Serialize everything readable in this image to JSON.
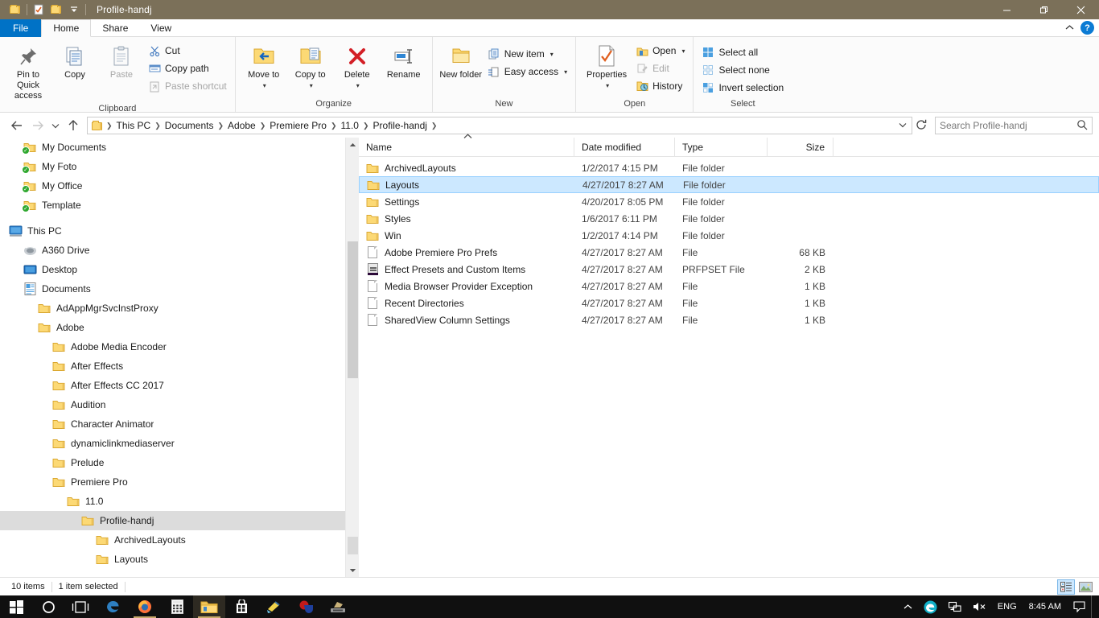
{
  "window": {
    "title": "Profile-handj",
    "titlebar_color": "#7b7059",
    "quick_access": [
      "folder-icon",
      "properties-icon",
      "new-folder-icon",
      "customize-dropdown"
    ],
    "controls": {
      "minimize": "—",
      "maximize": "❐",
      "close": "✕"
    }
  },
  "ribbon": {
    "tabs": [
      {
        "label": "File",
        "active": false,
        "kind": "file"
      },
      {
        "label": "Home",
        "active": true,
        "kind": "normal"
      },
      {
        "label": "Share",
        "active": false,
        "kind": "normal"
      },
      {
        "label": "View",
        "active": false,
        "kind": "normal"
      }
    ],
    "collapse_icon": "chevron-up-icon",
    "help_label": "?",
    "groups": [
      {
        "name": "Clipboard",
        "big_buttons": [
          {
            "label": "Pin to Quick access",
            "icon": "pin-icon",
            "disabled": false
          },
          {
            "label": "Copy",
            "icon": "copy-icon",
            "disabled": false
          },
          {
            "label": "Paste",
            "icon": "paste-icon",
            "disabled": true
          }
        ],
        "small_buttons": [
          {
            "label": "Cut",
            "icon": "scissors-icon",
            "disabled": false
          },
          {
            "label": "Copy path",
            "icon": "copy-path-icon",
            "disabled": false
          },
          {
            "label": "Paste shortcut",
            "icon": "paste-shortcut-icon",
            "disabled": true
          }
        ]
      },
      {
        "name": "Organize",
        "big_buttons": [
          {
            "label": "Move to",
            "icon": "move-to-icon",
            "dropdown": true
          },
          {
            "label": "Copy to",
            "icon": "copy-to-icon",
            "dropdown": true
          },
          {
            "label": "Delete",
            "icon": "delete-icon",
            "dropdown": true
          },
          {
            "label": "Rename",
            "icon": "rename-icon",
            "dropdown": false
          }
        ]
      },
      {
        "name": "New",
        "big_buttons": [
          {
            "label": "New folder",
            "icon": "new-folder-icon"
          }
        ],
        "small_buttons": [
          {
            "label": "New item",
            "icon": "new-item-icon",
            "dropdown": true
          },
          {
            "label": "Easy access",
            "icon": "easy-access-icon",
            "dropdown": true
          }
        ]
      },
      {
        "name": "Open",
        "big_buttons": [
          {
            "label": "Properties",
            "icon": "properties-icon",
            "dropdown": true
          }
        ],
        "small_buttons": [
          {
            "label": "Open",
            "icon": "open-icon",
            "dropdown": true,
            "disabled": false
          },
          {
            "label": "Edit",
            "icon": "edit-icon",
            "disabled": true
          },
          {
            "label": "History",
            "icon": "history-icon",
            "disabled": false
          }
        ]
      },
      {
        "name": "Select",
        "small_buttons": [
          {
            "label": "Select all",
            "icon": "select-all-icon"
          },
          {
            "label": "Select none",
            "icon": "select-none-icon"
          },
          {
            "label": "Invert selection",
            "icon": "invert-selection-icon"
          }
        ]
      }
    ]
  },
  "address": {
    "back_icon": "arrow-left-icon",
    "forward_icon": "arrow-right-icon",
    "recent_icon": "chevron-down-icon",
    "up_icon": "arrow-up-icon",
    "breadcrumbs": [
      "This PC",
      "Documents",
      "Adobe",
      "Premiere Pro",
      "11.0",
      "Profile-handj"
    ],
    "dropdown_icon": "chevron-down-icon",
    "refresh_icon": "refresh-icon"
  },
  "search": {
    "placeholder": "Search Profile-handj",
    "value": "",
    "icon": "search-icon"
  },
  "navpane": {
    "items": [
      {
        "label": "My Documents",
        "icon": "folder-synced-icon",
        "indent": 1,
        "selected": false
      },
      {
        "label": "My Foto",
        "icon": "folder-synced-icon",
        "indent": 1,
        "selected": false
      },
      {
        "label": "My Office",
        "icon": "folder-synced-icon",
        "indent": 1,
        "selected": false
      },
      {
        "label": "Template",
        "icon": "folder-synced-icon",
        "indent": 1,
        "selected": false
      },
      {
        "label": "This PC",
        "icon": "this-pc-icon",
        "indent": 0,
        "selected": false,
        "gap_before": true
      },
      {
        "label": "A360 Drive",
        "icon": "a360-drive-icon",
        "indent": 1,
        "selected": false
      },
      {
        "label": "Desktop",
        "icon": "desktop-icon",
        "indent": 1,
        "selected": false
      },
      {
        "label": "Documents",
        "icon": "documents-icon",
        "indent": 1,
        "selected": false
      },
      {
        "label": "AdAppMgrSvcInstProxy",
        "icon": "folder-icon",
        "indent": 2,
        "selected": false
      },
      {
        "label": "Adobe",
        "icon": "folder-icon",
        "indent": 2,
        "selected": false
      },
      {
        "label": "Adobe Media Encoder",
        "icon": "folder-icon",
        "indent": 3,
        "selected": false
      },
      {
        "label": "After Effects",
        "icon": "folder-icon",
        "indent": 3,
        "selected": false
      },
      {
        "label": "After Effects CC 2017",
        "icon": "folder-icon",
        "indent": 3,
        "selected": false
      },
      {
        "label": "Audition",
        "icon": "folder-icon",
        "indent": 3,
        "selected": false
      },
      {
        "label": "Character Animator",
        "icon": "folder-icon",
        "indent": 3,
        "selected": false
      },
      {
        "label": "dynamiclinkmediaserver",
        "icon": "folder-icon",
        "indent": 3,
        "selected": false
      },
      {
        "label": "Prelude",
        "icon": "folder-icon",
        "indent": 3,
        "selected": false
      },
      {
        "label": "Premiere Pro",
        "icon": "folder-icon",
        "indent": 3,
        "selected": false
      },
      {
        "label": "11.0",
        "icon": "folder-icon",
        "indent": 4,
        "selected": false
      },
      {
        "label": "Profile-handj",
        "icon": "folder-icon",
        "indent": 5,
        "selected": true
      },
      {
        "label": "ArchivedLayouts",
        "icon": "folder-icon",
        "indent": 6,
        "selected": false
      },
      {
        "label": "Layouts",
        "icon": "folder-icon",
        "indent": 6,
        "selected": false
      }
    ]
  },
  "filelist": {
    "columns": [
      {
        "key": "name",
        "label": "Name",
        "sorted": "asc"
      },
      {
        "key": "date",
        "label": "Date modified"
      },
      {
        "key": "type",
        "label": "Type"
      },
      {
        "key": "size",
        "label": "Size"
      }
    ],
    "sort_icon": "caret-up-icon",
    "rows": [
      {
        "name": "ArchivedLayouts",
        "date": "1/2/2017 4:15 PM",
        "type": "File folder",
        "size": "",
        "icon": "folder-icon",
        "selected": false
      },
      {
        "name": "Layouts",
        "date": "4/27/2017 8:27 AM",
        "type": "File folder",
        "size": "",
        "icon": "folder-icon",
        "selected": true
      },
      {
        "name": "Settings",
        "date": "4/20/2017 8:05 PM",
        "type": "File folder",
        "size": "",
        "icon": "folder-icon",
        "selected": false
      },
      {
        "name": "Styles",
        "date": "1/6/2017 6:11 PM",
        "type": "File folder",
        "size": "",
        "icon": "folder-icon",
        "selected": false
      },
      {
        "name": "Win",
        "date": "1/2/2017 4:14 PM",
        "type": "File folder",
        "size": "",
        "icon": "folder-icon",
        "selected": false
      },
      {
        "name": "Adobe Premiere Pro Prefs",
        "date": "4/27/2017 8:27 AM",
        "type": "File",
        "size": "68 KB",
        "icon": "document-icon",
        "selected": false
      },
      {
        "name": "Effect Presets and Custom Items",
        "date": "4/27/2017 8:27 AM",
        "type": "PRFPSET File",
        "size": "2 KB",
        "icon": "prfpset-icon",
        "selected": false
      },
      {
        "name": "Media Browser Provider Exception",
        "date": "4/27/2017 8:27 AM",
        "type": "File",
        "size": "1 KB",
        "icon": "document-icon",
        "selected": false
      },
      {
        "name": "Recent Directories",
        "date": "4/27/2017 8:27 AM",
        "type": "File",
        "size": "1 KB",
        "icon": "document-icon",
        "selected": false
      },
      {
        "name": "SharedView Column Settings",
        "date": "4/27/2017 8:27 AM",
        "type": "File",
        "size": "1 KB",
        "icon": "document-icon",
        "selected": false
      }
    ]
  },
  "statusbar": {
    "item_count": "10 items",
    "selection": "1 item selected",
    "details_view_icon": "details-view-icon",
    "thumbnail_view_icon": "large-icons-view-icon"
  },
  "taskbar": {
    "items": [
      {
        "name": "start-button",
        "icon": "windows-logo-icon"
      },
      {
        "name": "cortana-button",
        "icon": "circle-icon"
      },
      {
        "name": "task-view-button",
        "icon": "task-view-icon"
      },
      {
        "name": "edge-button",
        "icon": "edge-icon"
      },
      {
        "name": "firefox-button",
        "icon": "firefox-icon",
        "running": true
      },
      {
        "name": "calculator-button",
        "icon": "calculator-icon"
      },
      {
        "name": "file-explorer-button",
        "icon": "folder-icon",
        "active": true
      },
      {
        "name": "store-button",
        "icon": "store-icon"
      },
      {
        "name": "app-button-1",
        "icon": "paint-icon"
      },
      {
        "name": "app-button-2",
        "icon": "blue-app-icon"
      },
      {
        "name": "app-button-3",
        "icon": "scanner-icon"
      }
    ],
    "tray": {
      "overflow_icon": "chevron-up-icon",
      "edge_icon": "edge-tray-icon",
      "network_icon": "network-icon",
      "volume_icon": "volume-muted-icon",
      "language": "ENG",
      "clock": "8:45 AM",
      "action_center_icon": "action-center-icon"
    }
  }
}
